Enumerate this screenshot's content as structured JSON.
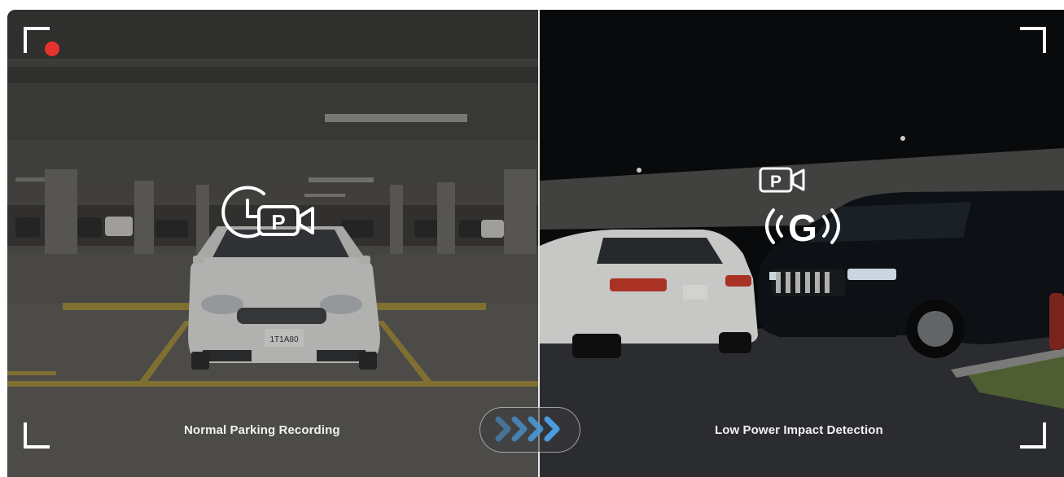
{
  "left_panel": {
    "caption": "Normal Parking Recording",
    "icon": "timelapse-parking-camera-icon"
  },
  "right_panel": {
    "caption": "Low Power Impact Detection",
    "icons": [
      "parking-camera-icon",
      "g-sensor-icon"
    ],
    "g_label": "G"
  },
  "plate_text": "1T1A80",
  "recording_indicator_color": "#e8322e",
  "arrow_color": "#4a9de0",
  "arrows": [
    "chevron",
    "chevron",
    "chevron",
    "chevron"
  ]
}
